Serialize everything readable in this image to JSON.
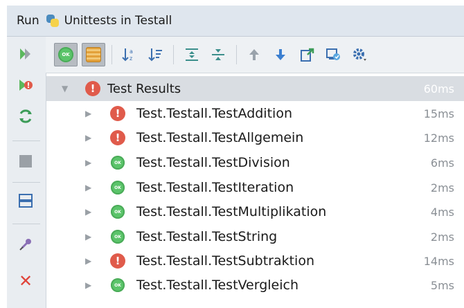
{
  "window": {
    "run_label": "Run",
    "config_name": "Unittests in Testall",
    "python_icon": "python-icon"
  },
  "left_toolbar": [
    {
      "name": "rerun-icon"
    },
    {
      "name": "rerun-failed-icon"
    },
    {
      "name": "toggle-auto-test-icon"
    },
    {
      "name": "stop-icon"
    },
    {
      "name": "layout-icon"
    },
    {
      "name": "pin-icon"
    },
    {
      "name": "close-icon"
    }
  ],
  "top_toolbar": [
    {
      "name": "show-passed-toggle",
      "label": "OK"
    },
    {
      "name": "show-ignored-toggle"
    },
    {
      "name": "sort-alphabetically-icon"
    },
    {
      "name": "sort-by-duration-icon"
    },
    {
      "name": "expand-all-icon"
    },
    {
      "name": "collapse-all-icon"
    },
    {
      "name": "previous-failed-icon"
    },
    {
      "name": "next-failed-icon"
    },
    {
      "name": "export-results-icon"
    },
    {
      "name": "import-results-icon"
    },
    {
      "name": "settings-icon"
    }
  ],
  "colors": {
    "pass": "#5bc46a",
    "fail": "#e05b4b",
    "header": "#d9dde2"
  },
  "results": {
    "root": {
      "label": "Test Results",
      "status": "fail",
      "time": "60ms"
    },
    "tests": [
      {
        "label": "Test.Testall.TestAddition",
        "status": "fail",
        "time": "15ms"
      },
      {
        "label": "Test.Testall.TestAllgemein",
        "status": "fail",
        "time": "12ms"
      },
      {
        "label": "Test.Testall.TestDivision",
        "status": "pass",
        "time": "6ms"
      },
      {
        "label": "Test.Testall.TestIteration",
        "status": "pass",
        "time": "2ms"
      },
      {
        "label": "Test.Testall.TestMultiplikation",
        "status": "pass",
        "time": "4ms"
      },
      {
        "label": "Test.Testall.TestString",
        "status": "pass",
        "time": "2ms"
      },
      {
        "label": "Test.Testall.TestSubtraktion",
        "status": "fail",
        "time": "14ms"
      },
      {
        "label": "Test.Testall.TestVergleich",
        "status": "pass",
        "time": "5ms"
      }
    ]
  }
}
